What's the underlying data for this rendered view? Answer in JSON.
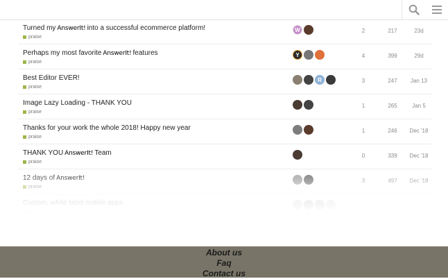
{
  "header": {
    "search_icon": "search-icon",
    "menu_icon": "hamburger-menu-icon"
  },
  "topics": [
    {
      "title_before": "Turned my",
      "brand": "AnswerIt!",
      "title_after": "into  a successful ecommerce platform!",
      "category": "praise",
      "replies": "2",
      "views": "217",
      "activity": "23d",
      "avatars": [
        {
          "letter": "W",
          "bg": "#c58ac9",
          "ring": "#e0e0e0"
        },
        {
          "letter": "",
          "bg": "#5a3b2c"
        }
      ]
    },
    {
      "title_before": "Perhaps my most favorite",
      "brand": "AnswerIt!",
      "title_after": "features",
      "category": "praise",
      "replies": "4",
      "views": "399",
      "activity": "29d",
      "avatars": [
        {
          "letter": "Y",
          "bg": "#2b2b2b",
          "ring": "#e69a26"
        },
        {
          "letter": "",
          "bg": "#777"
        },
        {
          "letter": "",
          "bg": "#e0713a"
        }
      ]
    },
    {
      "title_before": "Best Editor EVER!",
      "brand": "",
      "title_after": "",
      "category": "praise",
      "replies": "3",
      "views": "247",
      "activity": "Jan 13",
      "avatars": [
        {
          "letter": "",
          "bg": "#8a7f72"
        },
        {
          "letter": "",
          "bg": "#444"
        },
        {
          "letter": "R",
          "bg": "#8fb3d6"
        },
        {
          "letter": "",
          "bg": "#3a3a3a"
        }
      ]
    },
    {
      "title_before": "Image Lazy Loading - THANK YOU",
      "brand": "",
      "title_after": "",
      "category": "praise",
      "replies": "1",
      "views": "265",
      "activity": "Jan 5",
      "avatars": [
        {
          "letter": "",
          "bg": "#4a3b33"
        },
        {
          "letter": "",
          "bg": "#444"
        }
      ]
    },
    {
      "title_before": "Thanks for your work the whole 2018! Happy new year",
      "brand": "",
      "title_after": "",
      "category": "praise",
      "replies": "1",
      "views": "246",
      "activity": "Dec '18",
      "avatars": [
        {
          "letter": "",
          "bg": "#7d7d7d"
        },
        {
          "letter": "",
          "bg": "#5a3b2c"
        }
      ]
    },
    {
      "title_before": "THANK YOU",
      "brand": "AnswerIt!",
      "title_after": "Team",
      "category": "praise",
      "replies": "0",
      "views": "339",
      "activity": "Dec '18",
      "avatars": [
        {
          "letter": "",
          "bg": "#4a3b33"
        }
      ]
    },
    {
      "title_before": "12 days of",
      "brand": "AnswerIt!",
      "title_after": "",
      "category": "praise",
      "replies": "3",
      "views": "497",
      "activity": "Dec '18",
      "avatars": [
        {
          "letter": "",
          "bg": "#9a9a9a"
        },
        {
          "letter": "",
          "bg": "#666"
        }
      ]
    },
    {
      "title_before": "Custom, white label mobile apps",
      "brand": "",
      "title_after": "",
      "category": "praise",
      "replies": "",
      "views": "",
      "activity": "",
      "avatars": [
        {
          "letter": "",
          "bg": "#aaa"
        },
        {
          "letter": "",
          "bg": "#888"
        },
        {
          "letter": "",
          "bg": "#999"
        },
        {
          "letter": "",
          "bg": "#bbb"
        }
      ]
    }
  ],
  "colors": {
    "category": "#9cb648",
    "footer_bg": "#787568"
  },
  "footer": {
    "about": "About us",
    "faq": "Faq",
    "contact": "Contact us"
  }
}
